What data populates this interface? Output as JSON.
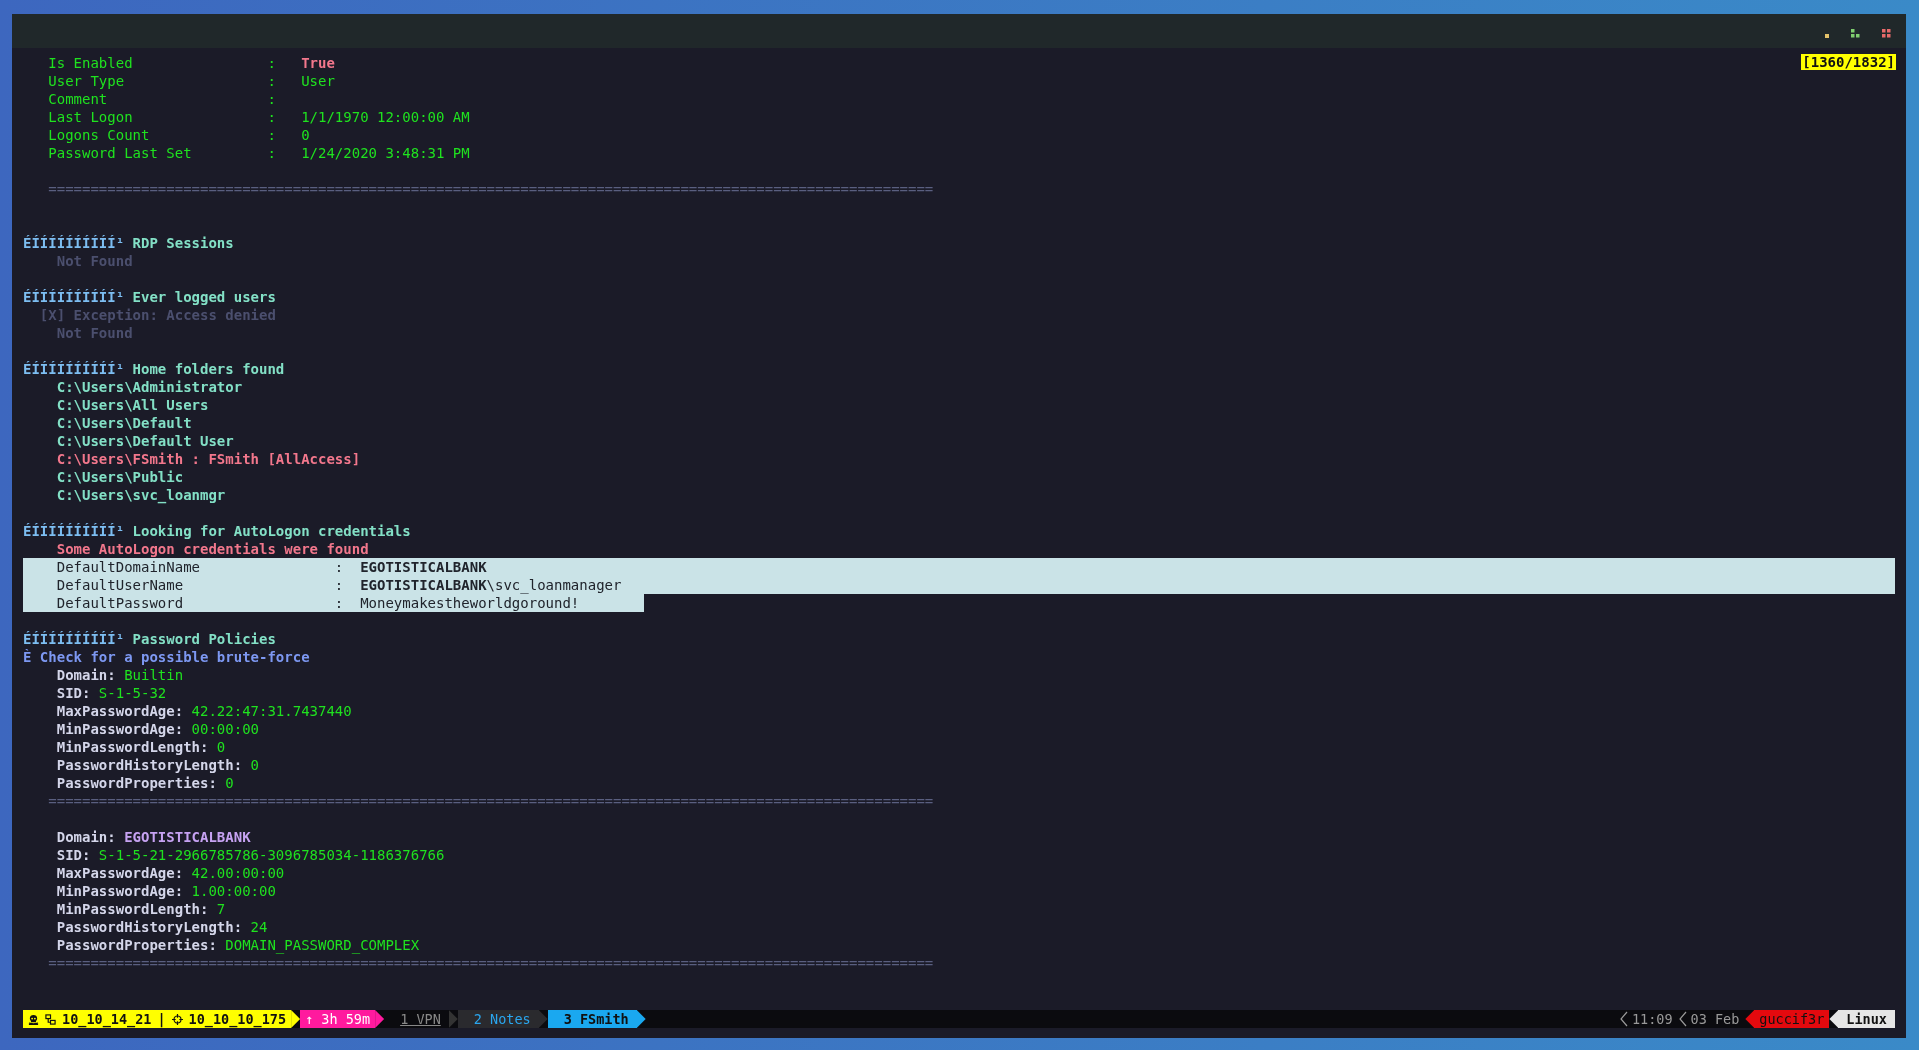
{
  "counter": "[1360/1832]",
  "lines": [
    {
      "kind": "kv",
      "label": "Is Enabled",
      "sep": ":",
      "value": "True",
      "color": "#f2778c"
    },
    {
      "kind": "kv",
      "label": "User Type",
      "sep": ":",
      "value": "User",
      "color": "#1fe21f"
    },
    {
      "kind": "kv",
      "label": "Comment",
      "sep": ":"
    },
    {
      "kind": "kv",
      "label": "Last Logon",
      "sep": ":",
      "value": "1/1/1970 12:00:00 AM",
      "color": "#1fe21f"
    },
    {
      "kind": "kv",
      "label": "Logons Count",
      "sep": ":",
      "value": "0",
      "color": "#1fe21f"
    },
    {
      "kind": "kv",
      "label": "Password Last Set",
      "sep": ":",
      "value": "1/24/2020 3:48:31 PM",
      "color": "#1fe21f"
    },
    {
      "kind": "blank"
    },
    {
      "kind": "rule",
      "text": "========================================================================================================="
    },
    {
      "kind": "blank"
    },
    {
      "kind": "blank"
    },
    {
      "kind": "heading",
      "marker": "ÉÍÍÍÍÍÍÍÍÍÍ¹",
      "title": "RDP Sessions"
    },
    {
      "kind": "note",
      "text": "Not Found"
    },
    {
      "kind": "blank"
    },
    {
      "kind": "heading",
      "marker": "ÉÍÍÍÍÍÍÍÍÍÍ¹",
      "title": "Ever logged users"
    },
    {
      "kind": "exception",
      "text": "[X] Exception: Access denied"
    },
    {
      "kind": "note",
      "text": "Not Found"
    },
    {
      "kind": "blank"
    },
    {
      "kind": "heading",
      "marker": "ÉÍÍÍÍÍÍÍÍÍÍ¹",
      "title": "Home folders found"
    },
    {
      "kind": "item",
      "text": "C:\\Users\\Administrator",
      "color": "#83e0c6"
    },
    {
      "kind": "item",
      "text": "C:\\Users\\All Users",
      "color": "#83e0c6"
    },
    {
      "kind": "item",
      "text": "C:\\Users\\Default",
      "color": "#83e0c6"
    },
    {
      "kind": "item",
      "text": "C:\\Users\\Default User",
      "color": "#83e0c6"
    },
    {
      "kind": "item",
      "text": "C:\\Users\\FSmith : FSmith [AllAccess]",
      "color": "#f2778c"
    },
    {
      "kind": "item",
      "text": "C:\\Users\\Public",
      "color": "#83e0c6"
    },
    {
      "kind": "item",
      "text": "C:\\Users\\svc_loanmgr",
      "color": "#83e0c6"
    },
    {
      "kind": "blank"
    },
    {
      "kind": "heading",
      "marker": "ÉÍÍÍÍÍÍÍÍÍÍ¹",
      "title": "Looking for AutoLogon credentials"
    },
    {
      "kind": "item",
      "text": "Some AutoLogon credentials were found",
      "color": "#f2778c"
    },
    {
      "kind": "cred",
      "label": "DefaultDomainName",
      "sep": ":",
      "value": "EGOTISTICALBANK",
      "bold": true,
      "selected": true,
      "to_line_end": true
    },
    {
      "kind": "cred",
      "label": "DefaultUserName",
      "sep": ":",
      "value": "**EGOTISTICALBANK**\\svc_loanmanager",
      "bold": false,
      "selected": true,
      "to_line_end": true
    },
    {
      "kind": "cred",
      "label": "DefaultPassword",
      "sep": ":",
      "value": "Moneymakestheworldgoround!",
      "bold": false,
      "selected": true,
      "to_line_end": false
    },
    {
      "kind": "blank"
    },
    {
      "kind": "heading",
      "marker": "ÉÍÍÍÍÍÍÍÍÍÍ¹",
      "title": "Password Policies"
    },
    {
      "kind": "subhead",
      "text": "È Check for a possible brute-force"
    },
    {
      "kind": "policy",
      "key": "Domain:",
      "value": "Builtin",
      "color": "#1fe21f"
    },
    {
      "kind": "policy",
      "key": "SID:",
      "value": "S-1-5-32",
      "color": "#1fe21f"
    },
    {
      "kind": "policy",
      "key": "MaxPasswordAge:",
      "value": "42.22:47:31.7437440",
      "color": "#1fe21f"
    },
    {
      "kind": "policy",
      "key": "MinPasswordAge:",
      "value": "00:00:00",
      "color": "#1fe21f"
    },
    {
      "kind": "policy",
      "key": "MinPasswordLength:",
      "value": "0",
      "color": "#1fe21f"
    },
    {
      "kind": "policy",
      "key": "PasswordHistoryLength:",
      "value": "0",
      "color": "#1fe21f"
    },
    {
      "kind": "policy",
      "key": "PasswordProperties:",
      "value": "0",
      "color": "#1fe21f"
    },
    {
      "kind": "rule",
      "text": "========================================================================================================="
    },
    {
      "kind": "blank"
    },
    {
      "kind": "policy",
      "key": "Domain:",
      "value": "EGOTISTICALBANK",
      "color": "#c6a2f2"
    },
    {
      "kind": "policy",
      "key": "SID:",
      "value": "S-1-5-21-2966785786-3096785034-1186376766",
      "color": "#1fe21f"
    },
    {
      "kind": "policy",
      "key": "MaxPasswordAge:",
      "value": "42.00:00:00",
      "color": "#1fe21f"
    },
    {
      "kind": "policy",
      "key": "MinPasswordAge:",
      "value": "1.00:00:00",
      "color": "#1fe21f"
    },
    {
      "kind": "policy",
      "key": "MinPasswordLength:",
      "value": "7",
      "color": "#1fe21f"
    },
    {
      "kind": "policy",
      "key": "PasswordHistoryLength:",
      "value": "24",
      "color": "#1fe21f"
    },
    {
      "kind": "policy",
      "key": "PasswordProperties:",
      "value": "DOMAIN_PASSWORD_COMPLEX",
      "color": "#1fe21f"
    },
    {
      "kind": "rule",
      "text": "========================================================================================================="
    }
  ],
  "status_bar": {
    "host": "10_10_14_21",
    "divider": "|",
    "target": "10_10_10_175",
    "uptime": "↑ 3h 59m",
    "windows": [
      {
        "label": "1 VPN",
        "selected": false,
        "last_used": false
      },
      {
        "label": "2 Notes",
        "selected": false,
        "last_used": true
      },
      {
        "label": "3 FSmith",
        "selected": true,
        "last_used": false
      }
    ],
    "time": "11:09",
    "date": "03 Feb",
    "user": "guccif3r",
    "os": "Linux"
  }
}
